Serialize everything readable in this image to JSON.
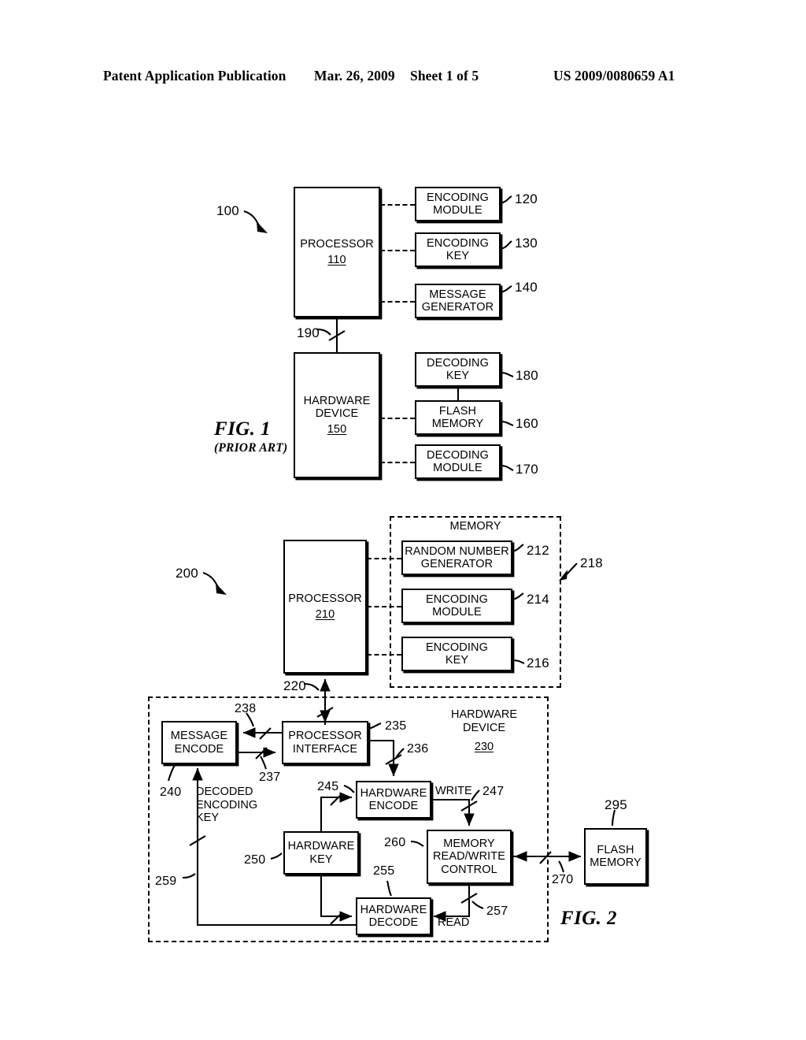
{
  "header": {
    "publication": "Patent Application Publication",
    "date": "Mar. 26, 2009",
    "sheet": "Sheet 1 of 5",
    "patent_number": "US 2009/0080659 A1"
  },
  "figure1": {
    "caption": "FIG. 1",
    "caption_sub": "(PRIOR ART)",
    "system_ref": "100",
    "blocks": {
      "processor": {
        "line1": "PROCESSOR",
        "ref": "110"
      },
      "encoding_module": {
        "line1": "ENCODING",
        "line2": "MODULE",
        "ref": "120"
      },
      "encoding_key": {
        "line1": "ENCODING",
        "line2": "KEY",
        "ref": "130"
      },
      "message_generator": {
        "line1": "MESSAGE",
        "line2": "GENERATOR",
        "ref": "140"
      },
      "hardware_device": {
        "line1": "HARDWARE",
        "line2": "DEVICE",
        "ref": "150"
      },
      "decoding_key": {
        "line1": "DECODING",
        "line2": "KEY",
        "ref": "180"
      },
      "flash_memory": {
        "line1": "FLASH",
        "line2": "MEMORY",
        "ref": "160"
      },
      "decoding_module": {
        "line1": "DECODING",
        "line2": "MODULE",
        "ref": "170"
      }
    },
    "bus_ref": "190"
  },
  "figure2": {
    "caption": "FIG. 2",
    "system_ref": "200",
    "memory_group": {
      "label": "MEMORY",
      "ref": "218"
    },
    "hardware_device_group": {
      "line1": "HARDWARE",
      "line2": "DEVICE",
      "ref": "230"
    },
    "blocks": {
      "processor": {
        "line1": "PROCESSOR",
        "ref": "210"
      },
      "random_number_generator": {
        "line1": "RANDOM NUMBER",
        "line2": "GENERATOR",
        "ref": "212"
      },
      "encoding_module": {
        "line1": "ENCODING",
        "line2": "MODULE",
        "ref": "214"
      },
      "encoding_key": {
        "line1": "ENCODING",
        "line2": "KEY",
        "ref": "216"
      },
      "message_encode": {
        "line1": "MESSAGE",
        "line2": "ENCODE",
        "ref": "240"
      },
      "processor_interface": {
        "line1": "PROCESSOR",
        "line2": "INTERFACE",
        "ref": "235"
      },
      "hardware_encode": {
        "line1": "HARDWARE",
        "line2": "ENCODE",
        "ref": "245"
      },
      "hardware_key": {
        "line1": "HARDWARE",
        "line2": "KEY",
        "ref": "250"
      },
      "hardware_decode": {
        "line1": "HARDWARE",
        "line2": "DECODE",
        "ref": "255"
      },
      "memory_read_write_control": {
        "line1": "MEMORY",
        "line2": "READ/WRITE",
        "line3": "CONTROL",
        "ref": "260"
      },
      "flash_memory": {
        "line1": "FLASH",
        "line2": "MEMORY",
        "ref": "295"
      }
    },
    "signals": {
      "processor_bus": "220",
      "interface_to_encode": "236",
      "encode_to_interface": "237",
      "interface_to_message": "238",
      "write_bus": "247",
      "read_bus": "257",
      "decoded_key_bus": "259",
      "flash_bus": "270"
    },
    "labels": {
      "decoded_encoding_key": "DECODED ENCODING KEY",
      "decoded_encoding_key_l1": "DECODED",
      "decoded_encoding_key_l2": "ENCODING",
      "decoded_encoding_key_l3": "KEY",
      "write": "WRITE",
      "read": "READ"
    }
  },
  "colors": {
    "ink": "#000000",
    "paper": "#ffffff"
  }
}
